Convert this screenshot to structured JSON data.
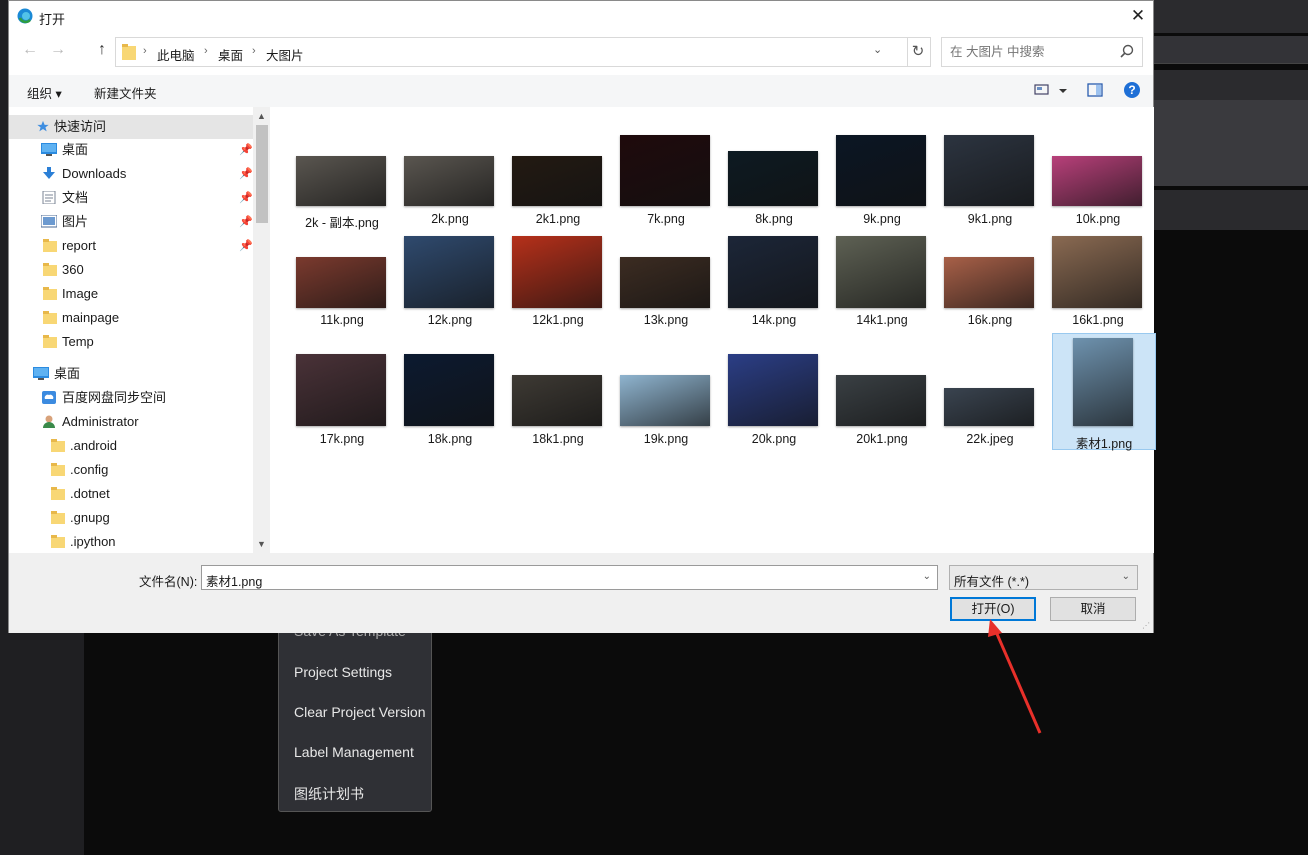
{
  "background_menu": {
    "items": [
      "Save As Template",
      "Project Settings",
      "Clear Project Version",
      "Label Management",
      "图纸计划书"
    ]
  },
  "dialog": {
    "title": "打开",
    "close_glyph": "✕"
  },
  "address": {
    "breadcrumb": [
      "此电脑",
      "桌面",
      "大图片"
    ],
    "search_placeholder": "在 大图片 中搜索"
  },
  "toolbar": {
    "organize": "组织 ▾",
    "new_folder": "新建文件夹"
  },
  "sidebar": {
    "items": [
      {
        "label": "快速访问",
        "icon": "star-icon",
        "pinned": false,
        "selected": true
      },
      {
        "label": "桌面",
        "icon": "desktop-icon",
        "pinned": true
      },
      {
        "label": "Downloads",
        "icon": "download-icon",
        "pinned": true
      },
      {
        "label": "文档",
        "icon": "document-icon",
        "pinned": true
      },
      {
        "label": "图片",
        "icon": "pictures-icon",
        "pinned": true
      },
      {
        "label": "report",
        "icon": "folder-icon",
        "pinned": true
      },
      {
        "label": "360",
        "icon": "folder-icon"
      },
      {
        "label": "Image",
        "icon": "folder-icon"
      },
      {
        "label": "mainpage",
        "icon": "folder-icon"
      },
      {
        "label": "Temp",
        "icon": "folder-icon"
      },
      {
        "label": "桌面",
        "icon": "desktop-icon"
      },
      {
        "label": "百度网盘同步空间",
        "icon": "cloud-icon"
      },
      {
        "label": "Administrator",
        "icon": "user-icon"
      },
      {
        "label": ".android",
        "icon": "folder-icon"
      },
      {
        "label": ".config",
        "icon": "folder-icon"
      },
      {
        "label": ".dotnet",
        "icon": "folder-icon"
      },
      {
        "label": ".gnupg",
        "icon": "folder-icon"
      },
      {
        "label": ".ipython",
        "icon": "folder-icon"
      }
    ]
  },
  "files": [
    {
      "name": "2k - 副本.png",
      "color": "#5a5650"
    },
    {
      "name": "2k.png",
      "color": "#5a5650"
    },
    {
      "name": "2k1.png",
      "color": "#231a12"
    },
    {
      "name": "7k.png",
      "color": "#1f0a0c"
    },
    {
      "name": "8k.png",
      "color": "#0d1a22"
    },
    {
      "name": "9k.png",
      "color": "#0b1624"
    },
    {
      "name": "9k1.png",
      "color": "#2c3440"
    },
    {
      "name": "10k.png",
      "color": "#b8407a"
    },
    {
      "name": "11k.png",
      "color": "#7b3a2e"
    },
    {
      "name": "12k.png",
      "color": "#2f4a6e"
    },
    {
      "name": "12k1.png",
      "color": "#b6301a"
    },
    {
      "name": "13k.png",
      "color": "#3c2c22"
    },
    {
      "name": "14k.png",
      "color": "#1c2638"
    },
    {
      "name": "14k1.png",
      "color": "#5e6154"
    },
    {
      "name": "16k.png",
      "color": "#a86048"
    },
    {
      "name": "16k1.png",
      "color": "#8a6a52"
    },
    {
      "name": "17k.png",
      "color": "#4a3238"
    },
    {
      "name": "18k.png",
      "color": "#0c1a30"
    },
    {
      "name": "18k1.png",
      "color": "#3e3a34"
    },
    {
      "name": "19k.png",
      "color": "#8fb4cf"
    },
    {
      "name": "20k.png",
      "color": "#2b3e86"
    },
    {
      "name": "20k1.png",
      "color": "#3a4044"
    },
    {
      "name": "22k.jpeg",
      "color": "#3a4450"
    },
    {
      "name": "素材1.png",
      "color": "#6e92ae",
      "selected": true
    }
  ],
  "footer": {
    "filename_label": "文件名(N):",
    "filename_value": "素材1.png",
    "filetype_value": "所有文件 (*.*)",
    "open_label": "打开(O)",
    "cancel_label": "取消"
  }
}
